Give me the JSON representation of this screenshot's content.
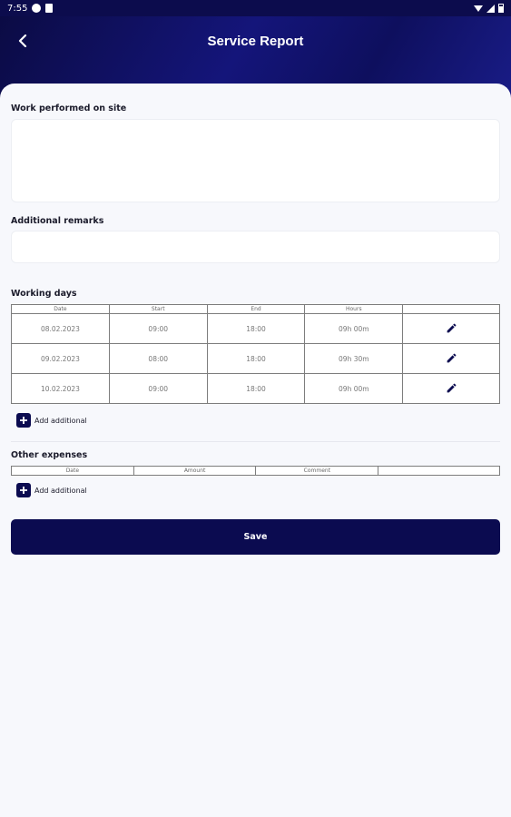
{
  "status_bar": {
    "time": "7:55",
    "icons": [
      "notification-badge-icon",
      "sim-card-icon",
      "wifi-icon",
      "signal-icon",
      "battery-icon"
    ]
  },
  "header": {
    "title": "Service Report",
    "back_icon": "chevron-left-icon",
    "colors": {
      "dark": "#0b0b44",
      "mid": "#14157a"
    }
  },
  "work_performed": {
    "label": "Work performed on site",
    "value": "",
    "placeholder": ""
  },
  "additional_remarks": {
    "label": "Additional remarks",
    "value": "",
    "placeholder": ""
  },
  "working_days": {
    "label": "Working days",
    "columns": [
      "Date",
      "Start",
      "End",
      "Hours",
      ""
    ],
    "rows": [
      {
        "date": "08.02.2023",
        "start": "09:00",
        "end": "18:00",
        "hours": "09h 00m",
        "action_icon": "pencil-icon"
      },
      {
        "date": "09.02.2023",
        "start": "08:00",
        "end": "18:00",
        "hours": "09h 30m",
        "action_icon": "pencil-icon"
      },
      {
        "date": "10.02.2023",
        "start": "09:00",
        "end": "18:00",
        "hours": "09h 00m",
        "action_icon": "pencil-icon"
      }
    ],
    "add_label": "Add additional"
  },
  "other_expenses": {
    "label": "Other expenses",
    "columns": [
      "Date",
      "Amount",
      "Comment",
      ""
    ],
    "add_label": "Add additional"
  },
  "save_label": "Save",
  "accent_color": "#0b0b50"
}
